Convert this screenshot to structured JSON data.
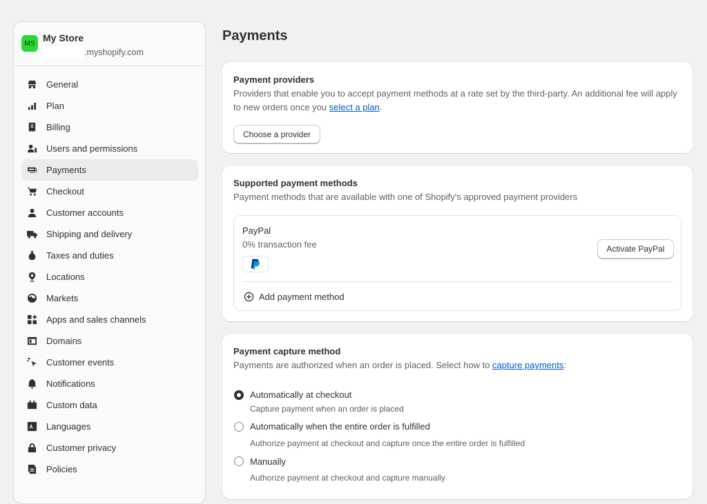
{
  "store": {
    "initials": "MS",
    "name": "My Store",
    "domain": ".myshopify.com"
  },
  "sidebar": {
    "items": [
      {
        "label": "General",
        "icon": "store-icon"
      },
      {
        "label": "Plan",
        "icon": "plan-icon"
      },
      {
        "label": "Billing",
        "icon": "billing-icon"
      },
      {
        "label": "Users and permissions",
        "icon": "users-icon"
      },
      {
        "label": "Payments",
        "icon": "payments-icon",
        "active": true
      },
      {
        "label": "Checkout",
        "icon": "cart-icon"
      },
      {
        "label": "Customer accounts",
        "icon": "person-icon"
      },
      {
        "label": "Shipping and delivery",
        "icon": "truck-icon"
      },
      {
        "label": "Taxes and duties",
        "icon": "tax-icon"
      },
      {
        "label": "Locations",
        "icon": "location-icon"
      },
      {
        "label": "Markets",
        "icon": "globe-icon"
      },
      {
        "label": "Apps and sales channels",
        "icon": "apps-icon"
      },
      {
        "label": "Domains",
        "icon": "domain-icon"
      },
      {
        "label": "Customer events",
        "icon": "cursor-icon"
      },
      {
        "label": "Notifications",
        "icon": "bell-icon"
      },
      {
        "label": "Custom data",
        "icon": "data-icon"
      },
      {
        "label": "Languages",
        "icon": "language-icon"
      },
      {
        "label": "Customer privacy",
        "icon": "lock-icon"
      },
      {
        "label": "Policies",
        "icon": "policy-icon"
      }
    ]
  },
  "page": {
    "title": "Payments"
  },
  "providers": {
    "title": "Payment providers",
    "text_before": "Providers that enable you to accept payment methods at a rate set by the third-party. An additional fee will apply to new orders once you ",
    "link": "select a plan",
    "text_after": ".",
    "button": "Choose a provider"
  },
  "methods": {
    "title": "Supported payment methods",
    "text": "Payment methods that are available with one of Shopify's approved payment providers",
    "paypal_name": "PayPal",
    "paypal_fee": "0% transaction fee",
    "activate_button": "Activate PayPal",
    "add_method": "Add payment method"
  },
  "capture": {
    "title": "Payment capture method",
    "text_before": "Payments are authorized when an order is placed. Select how to ",
    "link": "capture payments",
    "text_after": ":",
    "options": [
      {
        "label": "Automatically at checkout",
        "help": "Capture payment when an order is placed",
        "checked": true
      },
      {
        "label": "Automatically when the entire order is fulfilled",
        "help": "Authorize payment at checkout and capture once the entire order is fulfilled",
        "checked": false
      },
      {
        "label": "Manually",
        "help": "Authorize payment at checkout and capture manually",
        "checked": false
      }
    ]
  },
  "colors": {
    "accent_link": "#005bd3",
    "avatar_bg": "#29d834",
    "paypal_dark": "#003087",
    "paypal_light": "#009cde"
  }
}
